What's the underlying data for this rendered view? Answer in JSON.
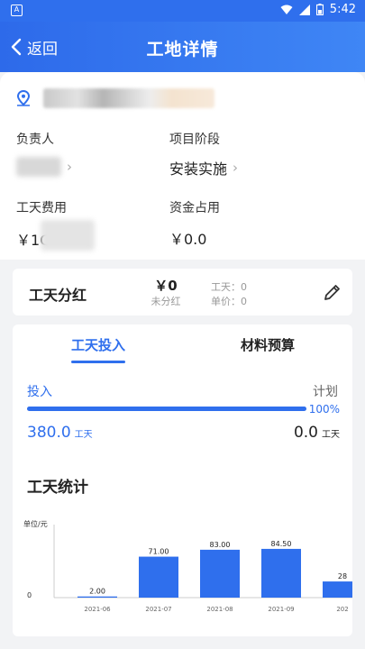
{
  "status_bar": {
    "time": "5:42"
  },
  "app_bar": {
    "back_label": "返回",
    "title": "工地详情"
  },
  "site": {
    "fields": {
      "owner_label": "负责人",
      "stage_label": "项目阶段",
      "stage_value": "安装实施",
      "labor_cost_label": "工天费用",
      "labor_cost_value": "￥1C",
      "fund_label": "资金占用",
      "fund_value": "￥0.0"
    }
  },
  "bonus": {
    "title": "工天分红",
    "amount": "￥0",
    "amount_caption": "未分红",
    "days": "工天：0",
    "unit_price": "单价：0"
  },
  "tabs": [
    {
      "label": "工天投入",
      "active": true
    },
    {
      "label": "材料预算",
      "active": false
    }
  ],
  "investment": {
    "input_label": "投入",
    "plan_label": "计划",
    "progress_fraction": 1.0,
    "progress_text": "100%",
    "input_value": "380.0",
    "input_unit": "工天",
    "plan_value": "0.0",
    "plan_unit": "工天"
  },
  "stats": {
    "title": "工天统计"
  },
  "chart_data": {
    "type": "bar",
    "ylabel": "单位/元",
    "y_tick_labels": [
      "0"
    ],
    "categories": [
      "2021-06",
      "2021-07",
      "2021-08",
      "2021-09",
      "202"
    ],
    "values": [
      2.0,
      71.0,
      83.0,
      84.5,
      28
    ],
    "value_labels": [
      "2.00",
      "71.00",
      "83.00",
      "84.50",
      "28"
    ],
    "ylim": [
      0,
      100
    ],
    "color": "#2f6fed"
  },
  "colors": {
    "accent": "#2f6fed",
    "background": "#f2f3f5"
  }
}
